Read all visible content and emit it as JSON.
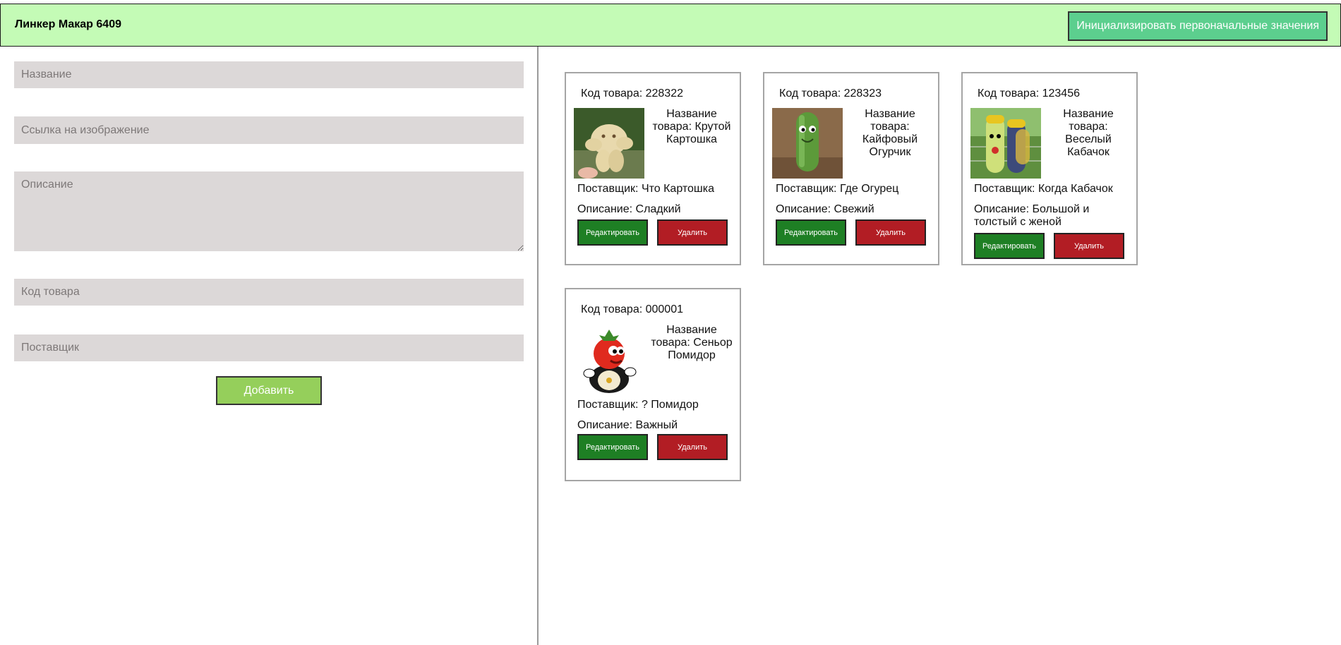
{
  "header": {
    "title": "Линкер Макар 6409",
    "init_button": "Инициализировать первоначальные значения"
  },
  "form": {
    "name_placeholder": "Название",
    "image_placeholder": "Ссылка на изображение",
    "description_placeholder": "Описание",
    "code_placeholder": "Код товара",
    "supplier_placeholder": "Поставщик",
    "add_button": "Добавить"
  },
  "cards": [
    {
      "code": "Код товара: 228322",
      "name": "Название товара: Крутой Картошка",
      "supplier": "Поставщик: Что Картошка",
      "description": "Описание: Сладкий",
      "image_icon": "potato-image",
      "edit_label": "Редактировать",
      "delete_label": "Удалить"
    },
    {
      "code": "Код товара: 228323",
      "name": "Название товара: Кайфовый Огурчик",
      "supplier": "Поставщик: Где Огурец",
      "description": "Описание: Свежий",
      "image_icon": "cucumber-image",
      "edit_label": "Редактировать",
      "delete_label": "Удалить"
    },
    {
      "code": "Код товара: 123456",
      "name": "Название товара: Веселый Кабачок",
      "supplier": "Поставщик: Когда Кабачок",
      "description": "Описание: Большой и толстый с женой",
      "image_icon": "zucchini-image",
      "edit_label": "Редактировать",
      "delete_label": "Удалить"
    },
    {
      "code": "Код товара: 000001",
      "name": "Название товара: Сеньор Помидор",
      "supplier": "Поставщик: ? Помидор",
      "description": "Описание: Важный",
      "image_icon": "tomato-image",
      "edit_label": "Редактировать",
      "delete_label": "Удалить"
    }
  ],
  "colors": {
    "header_bg": "#c4fbb6",
    "init_button_bg": "#5ccf8e",
    "add_button_bg": "#95cf5b",
    "edit_button_bg": "#1e7f24",
    "delete_button_bg": "#b21d24",
    "field_bg": "#dcd8d8"
  }
}
